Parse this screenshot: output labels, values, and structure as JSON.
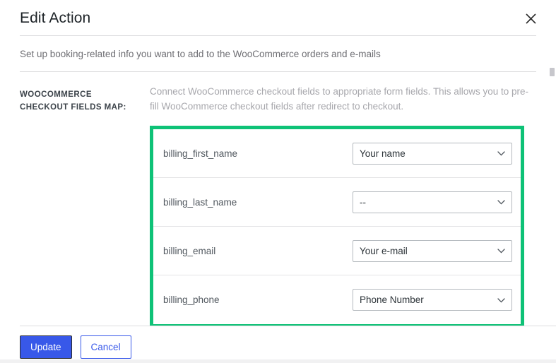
{
  "modal": {
    "title": "Edit Action",
    "close_icon": "close-icon",
    "intro": "Set up booking-related info you want to add to the WooCommerce orders and e-mails"
  },
  "section": {
    "label": "WOOCOMMERCE CHECKOUT FIELDS MAP:",
    "description": "Connect WooCommerce checkout fields to appropriate form fields. This allows you to pre-fill WooCommerce checkout fields after redirect to checkout.",
    "highlight_color": "#0ec277"
  },
  "field_map": {
    "rows": [
      {
        "key": "billing_first_name",
        "selected": "Your name",
        "options": [
          "--",
          "Your name",
          "Your e-mail",
          "Phone Number"
        ]
      },
      {
        "key": "billing_last_name",
        "selected": "--",
        "options": [
          "--",
          "Your name",
          "Your e-mail",
          "Phone Number"
        ]
      },
      {
        "key": "billing_email",
        "selected": "Your e-mail",
        "options": [
          "--",
          "Your name",
          "Your e-mail",
          "Phone Number"
        ]
      },
      {
        "key": "billing_phone",
        "selected": "Phone Number",
        "options": [
          "--",
          "Your name",
          "Your e-mail",
          "Phone Number"
        ]
      }
    ]
  },
  "footer": {
    "update_label": "Update",
    "cancel_label": "Cancel",
    "primary_color": "#3858e9"
  }
}
